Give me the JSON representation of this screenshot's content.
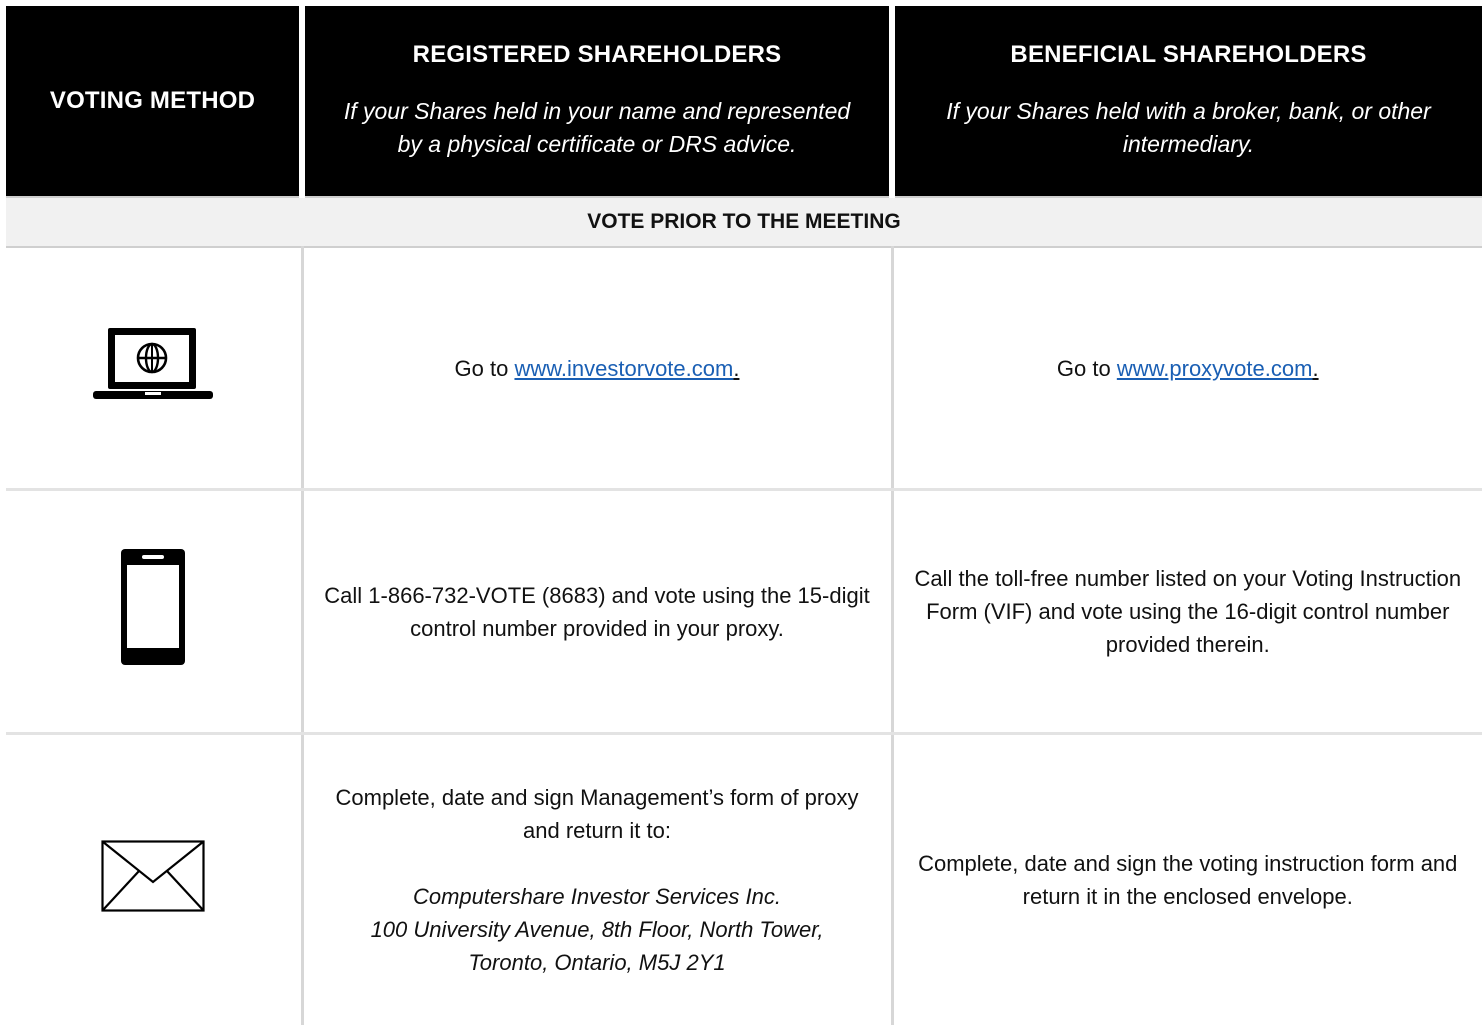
{
  "header": {
    "col1_title": "VOTING METHOD",
    "col2_title": "REGISTERED SHAREHOLDERS",
    "col2_sub": "If your Shares held in your name and represented by a physical certificate or DRS advice.",
    "col3_title": "BENEFICIAL SHAREHOLDERS",
    "col3_sub": "If your Shares held with a broker, bank, or other intermediary."
  },
  "section": {
    "label": "VOTE PRIOR TO THE MEETING"
  },
  "rows": [
    {
      "icon": "laptop-globe-icon",
      "registered": {
        "prefix": "Go to ",
        "link": "www.investorvote.com",
        "suffix": "."
      },
      "beneficial": {
        "prefix": "Go to ",
        "link": "www.proxyvote.com",
        "suffix": "."
      }
    },
    {
      "icon": "mobile-phone-icon",
      "registered": {
        "text": "Call 1-866-732-VOTE (8683) and vote using the 15-digit control number provided in your proxy."
      },
      "beneficial": {
        "text": "Call the toll-free number listed on your Voting Instruction Form (VIF) and vote using the 16-digit control number provided therein."
      }
    },
    {
      "icon": "envelope-icon",
      "registered": {
        "line1": "Complete, date and sign Management’s form of proxy and return it to:",
        "addr1": "Computershare Investor Services Inc.",
        "addr2": "100 University Avenue, 8th Floor, North Tower,",
        "addr3": "Toronto, Ontario, M5J 2Y1"
      },
      "beneficial": {
        "text": "Complete, date and sign the voting instruction form and return it in the enclosed envelope."
      }
    }
  ]
}
